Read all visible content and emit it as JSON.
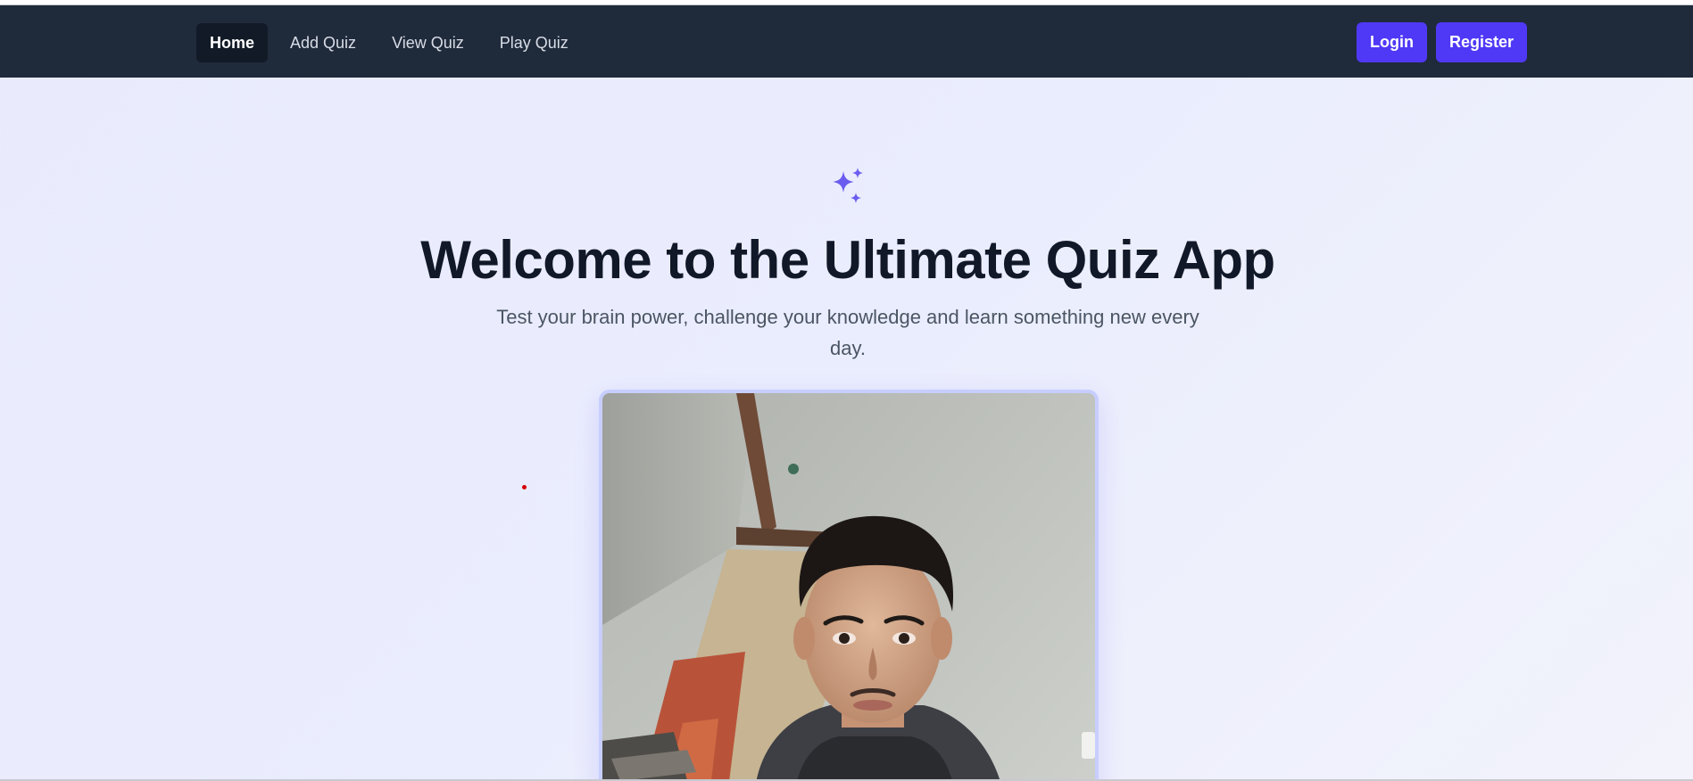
{
  "nav": {
    "links": [
      {
        "label": "Home",
        "active": true
      },
      {
        "label": "Add Quiz"
      },
      {
        "label": "View Quiz"
      },
      {
        "label": "Play Quiz"
      }
    ],
    "login_label": "Login",
    "register_label": "Register"
  },
  "hero": {
    "icon": "sparkles-icon",
    "title": "Welcome to the Ultimate Quiz App",
    "subtitle": "Test your brain power, challenge your knowledge and learn something new every day."
  },
  "colors": {
    "navbar": "#1f2a3b",
    "accent": "#4f39f6",
    "sparkle": "#6b5cf0",
    "title": "#111827",
    "subtitle": "#4b5563",
    "card_border": "#c7ceff"
  }
}
